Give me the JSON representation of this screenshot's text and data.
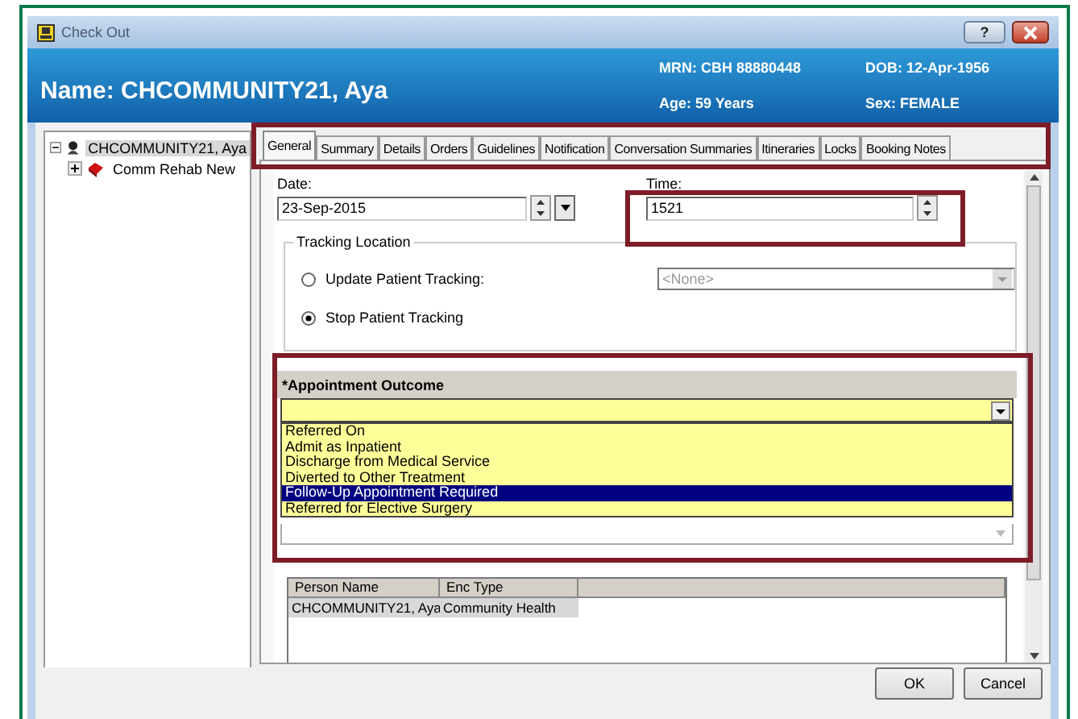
{
  "window": {
    "title": "Check Out",
    "help_label": "?"
  },
  "header": {
    "name": "Name: CHCOMMUNITY21, Aya",
    "mrn": "MRN: CBH 88880448",
    "dob": "DOB: 12-Apr-1956",
    "age": "Age:  59 Years",
    "sex": "Sex: FEMALE"
  },
  "tree": [
    {
      "label": "CHCOMMUNITY21, Aya",
      "expanded": true,
      "selected": true,
      "children": [
        {
          "label": "Comm Rehab New",
          "expanded": false,
          "selected": false
        }
      ]
    }
  ],
  "tabs": [
    {
      "label": "General",
      "selected": true
    },
    {
      "label": "Summary",
      "selected": false
    },
    {
      "label": "Details",
      "selected": false
    },
    {
      "label": "Orders",
      "selected": false
    },
    {
      "label": "Guidelines",
      "selected": false
    },
    {
      "label": "Notification",
      "selected": false
    },
    {
      "label": "Conversation Summaries",
      "selected": false
    },
    {
      "label": "Itineraries",
      "selected": false
    },
    {
      "label": "Locks",
      "selected": false
    },
    {
      "label": "Booking Notes",
      "selected": false
    }
  ],
  "form": {
    "date_label": "Date:",
    "date_value": "23-Sep-2015",
    "time_label": "Time:",
    "time_value": "1521",
    "tracking": {
      "title": "Tracking Location",
      "options": [
        {
          "label": "Update Patient Tracking:",
          "selected": false
        },
        {
          "label": "Stop Patient Tracking",
          "selected": true
        }
      ],
      "location_placeholder": "<None>",
      "location_disabled": true
    },
    "outcome": {
      "label": "*Appointment Outcome",
      "expanded": true,
      "options": [
        {
          "label": "Referred On",
          "selected": false
        },
        {
          "label": "Admit as Inpatient",
          "selected": false
        },
        {
          "label": "Discharge from Medical Service",
          "selected": false
        },
        {
          "label": "Diverted to Other Treatment",
          "selected": false
        },
        {
          "label": "Follow-Up Appointment Required",
          "selected": true
        },
        {
          "label": "Referred for Elective Surgery",
          "selected": false
        }
      ]
    },
    "table": {
      "columns": [
        "Person Name",
        "Enc Type"
      ],
      "rows": [
        [
          "CHCOMMUNITY21, Aya",
          "Community Health"
        ]
      ]
    }
  },
  "buttons": [
    "OK",
    "Cancel"
  ]
}
